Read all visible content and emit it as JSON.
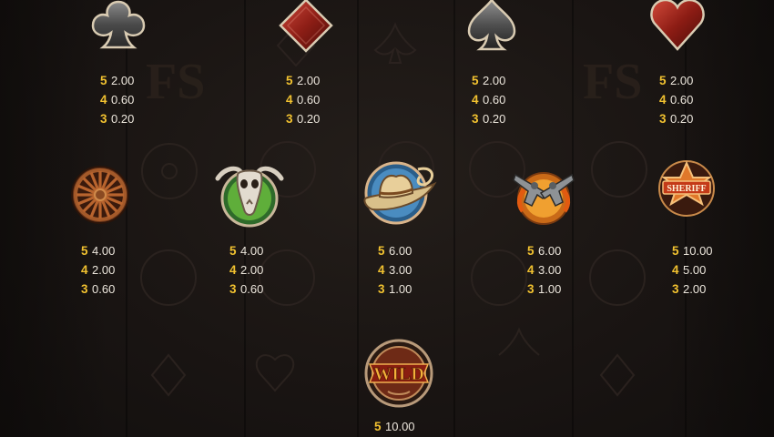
{
  "symbols": [
    {
      "id": "club",
      "name": "club-symbol-icon",
      "pays": [
        {
          "count": "5",
          "value": "2.00"
        },
        {
          "count": "4",
          "value": "0.60"
        },
        {
          "count": "3",
          "value": "0.20"
        }
      ]
    },
    {
      "id": "diamond",
      "name": "diamond-symbol-icon",
      "pays": [
        {
          "count": "5",
          "value": "2.00"
        },
        {
          "count": "4",
          "value": "0.60"
        },
        {
          "count": "3",
          "value": "0.20"
        }
      ]
    },
    {
      "id": "spade",
      "name": "spade-symbol-icon",
      "pays": [
        {
          "count": "5",
          "value": "2.00"
        },
        {
          "count": "4",
          "value": "0.60"
        },
        {
          "count": "3",
          "value": "0.20"
        }
      ]
    },
    {
      "id": "heart",
      "name": "heart-symbol-icon",
      "pays": [
        {
          "count": "5",
          "value": "2.00"
        },
        {
          "count": "4",
          "value": "0.60"
        },
        {
          "count": "3",
          "value": "0.20"
        }
      ]
    },
    {
      "id": "wheel",
      "name": "wagon-wheel-symbol-icon",
      "pays": [
        {
          "count": "5",
          "value": "4.00"
        },
        {
          "count": "4",
          "value": "2.00"
        },
        {
          "count": "3",
          "value": "0.60"
        }
      ]
    },
    {
      "id": "skull",
      "name": "bull-skull-symbol-icon",
      "pays": [
        {
          "count": "5",
          "value": "4.00"
        },
        {
          "count": "4",
          "value": "2.00"
        },
        {
          "count": "3",
          "value": "0.60"
        }
      ]
    },
    {
      "id": "hat",
      "name": "cowboy-hat-symbol-icon",
      "pays": [
        {
          "count": "5",
          "value": "6.00"
        },
        {
          "count": "4",
          "value": "3.00"
        },
        {
          "count": "3",
          "value": "1.00"
        }
      ]
    },
    {
      "id": "guns",
      "name": "crossed-revolvers-symbol-icon",
      "pays": [
        {
          "count": "5",
          "value": "6.00"
        },
        {
          "count": "4",
          "value": "3.00"
        },
        {
          "count": "3",
          "value": "1.00"
        }
      ]
    },
    {
      "id": "sheriff",
      "name": "sheriff-badge-symbol-icon",
      "label": "SHERIFF",
      "pays": [
        {
          "count": "5",
          "value": "10.00"
        },
        {
          "count": "4",
          "value": "5.00"
        },
        {
          "count": "3",
          "value": "2.00"
        }
      ]
    },
    {
      "id": "wild",
      "name": "wild-symbol-icon",
      "label": "WILD",
      "pays": [
        {
          "count": "5",
          "value": "10.00"
        }
      ]
    }
  ],
  "colors": {
    "count": "#f2c230",
    "value": "#ece6dc",
    "background": "#1a1614"
  }
}
